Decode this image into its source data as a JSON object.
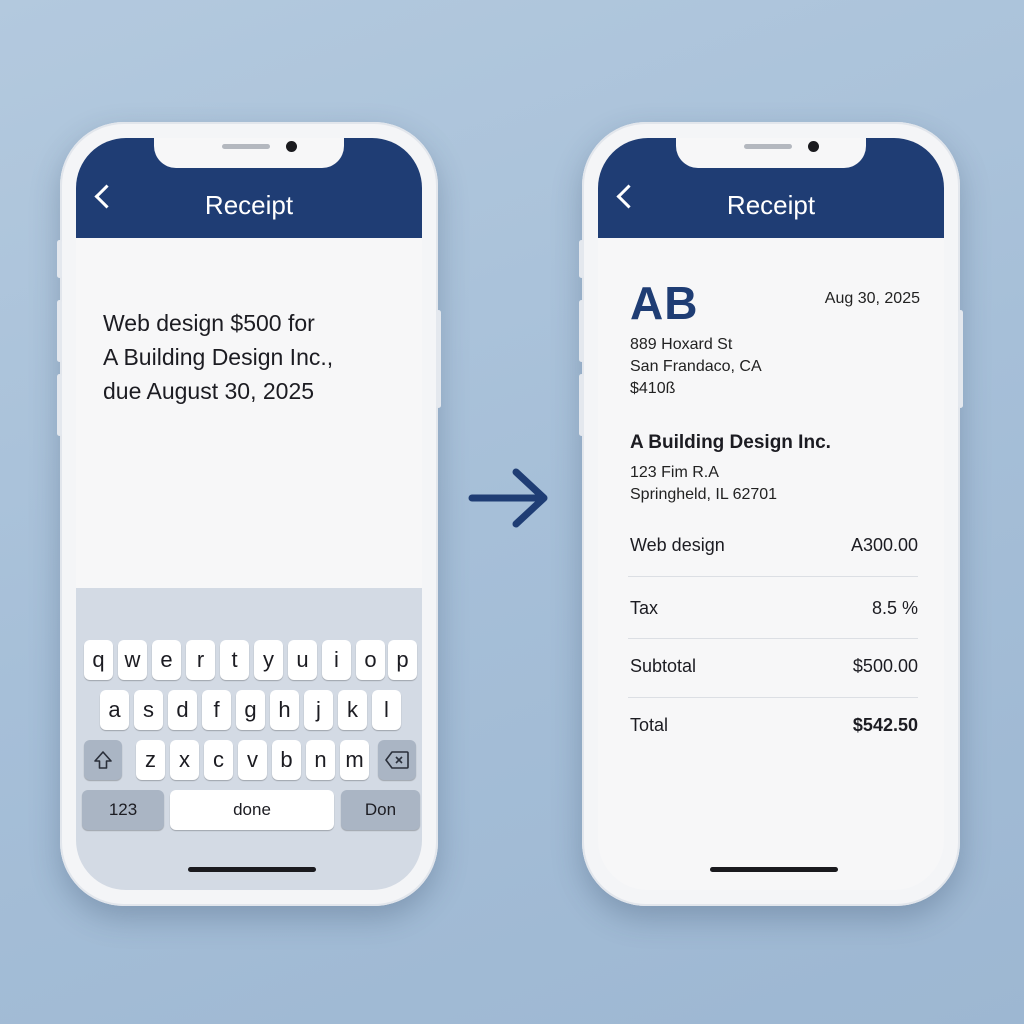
{
  "left_phone": {
    "header_title": "Receipt",
    "typed_text": [
      "Web design $500 for",
      "A Building Design Inc.,",
      "due August 30, 2025"
    ],
    "keyboard": {
      "row1": [
        "q",
        "w",
        "e",
        "r",
        "t",
        "y",
        "u",
        "i",
        "o",
        "p"
      ],
      "row2": [
        "a",
        "s",
        "d",
        "f",
        "g",
        "h",
        "j",
        "k",
        "l"
      ],
      "row3": [
        "z",
        "x",
        "c",
        "v",
        "b",
        "n",
        "m"
      ],
      "numbers_label": "123",
      "space_label": "done",
      "return_label": "Don"
    }
  },
  "right_phone": {
    "header_title": "Receipt",
    "logo_text": "AB",
    "date": "Aug 30, 2025",
    "sender_address": [
      "889 Hoxard St",
      "San Frandaco, CA",
      "$410ß"
    ],
    "client_name": "A Building Design Inc.",
    "client_address": [
      "123 Fim R.A",
      "Springheld, IL 62701"
    ],
    "line_items": [
      {
        "label": "Web design",
        "value": "A300.00"
      },
      {
        "label": "Tax",
        "value": "8.5 %"
      },
      {
        "label": "Subtotal",
        "value": "$500.00"
      },
      {
        "label": "Total",
        "value": "$542.50"
      }
    ]
  },
  "colors": {
    "header_blue": "#1f3d74",
    "background": "#a9c1d9",
    "arrow": "#1f3d74"
  }
}
